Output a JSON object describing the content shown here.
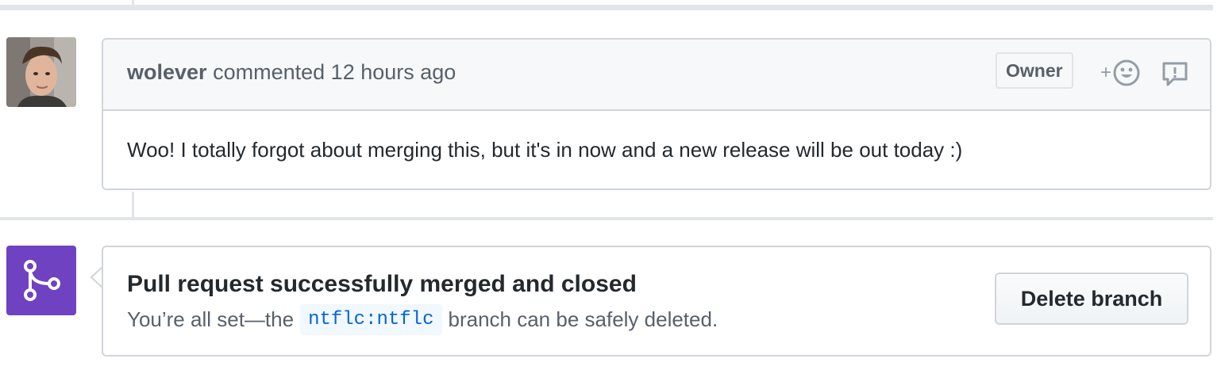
{
  "comment": {
    "author": "wolever",
    "action_text": "commented",
    "time": "12 hours ago",
    "badge": "Owner",
    "reaction_plus": "+",
    "body": "Woo! I totally forgot about merging this, but it's in now and a new release will be out today :)"
  },
  "merge_status": {
    "title": "Pull request successfully merged and closed",
    "desc_prefix": "You’re all set—the",
    "branch": "ntflc:ntflc",
    "desc_suffix": "branch can be safely deleted.",
    "delete_button_label": "Delete branch"
  },
  "colors": {
    "merged_purple": "#6f42c1",
    "border": "#d1d5da",
    "header_bg": "#f6f8fa",
    "muted_text": "#586069"
  },
  "icons": {
    "avatar": "user-avatar",
    "reaction": "smiley-icon",
    "report": "report-icon",
    "merge": "git-merge-icon"
  }
}
